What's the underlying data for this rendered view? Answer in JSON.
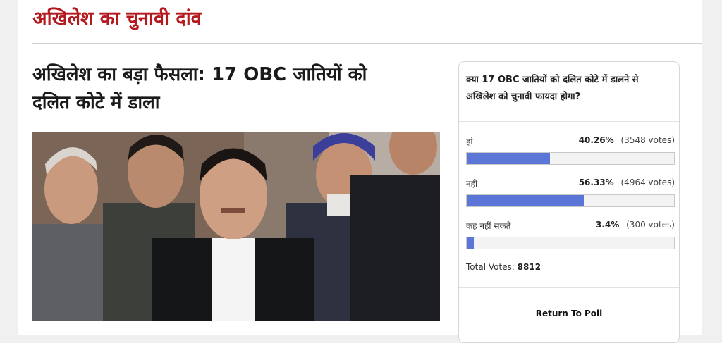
{
  "section": {
    "title": "अखिलेश का चुनावी दांव"
  },
  "article": {
    "headline_line1": "अखिलेश का बड़ा फैसला: 17 OBC जातियों को",
    "headline_line2": "दलित कोटे में डाला"
  },
  "poll": {
    "question_line1": "क्या 17 OBC जातियों को दलित कोटे में डालने से",
    "question_line2": "अखिलेश को चुनावी फायदा होगा?",
    "options": [
      {
        "label": "हां",
        "percent": "40.26%",
        "votes": "(3548 votes)",
        "fraction": 0.4026
      },
      {
        "label": "नहीं",
        "percent": "56.33%",
        "votes": "(4964 votes)",
        "fraction": 0.5633
      },
      {
        "label": "कह नहीं सकते",
        "percent": "3.4%",
        "votes": "(300 votes)",
        "fraction": 0.034
      }
    ],
    "total_label": "Total Votes:",
    "total_value": "8812",
    "return_label": "Return To Poll",
    "bar_color": "#5b76d6"
  }
}
